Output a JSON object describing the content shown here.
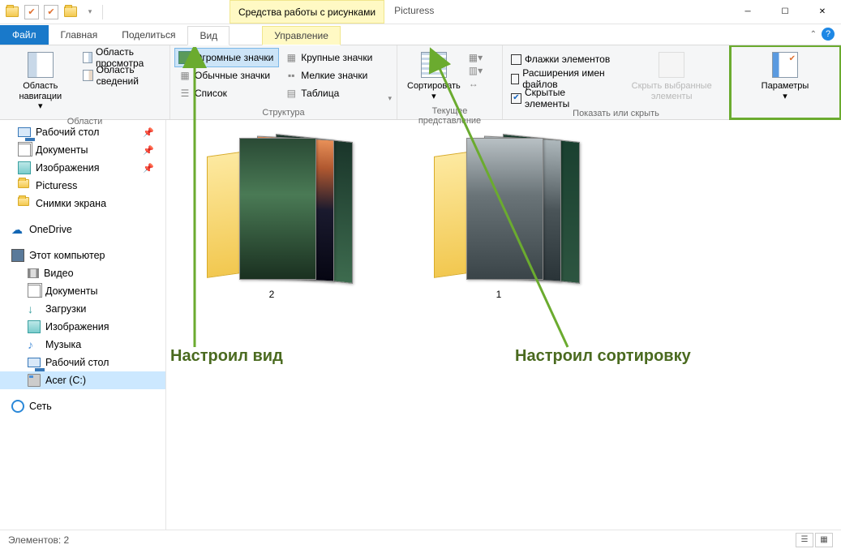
{
  "titlebar": {
    "context_tools": "Средства работы с рисунками",
    "window_title": "Picturess"
  },
  "tabs": {
    "file": "Файл",
    "home": "Главная",
    "share": "Поделиться",
    "view": "Вид",
    "manage": "Управление"
  },
  "ribbon": {
    "areas": {
      "nav_pane": "Область навигации",
      "preview_pane": "Область просмотра",
      "details_pane": "Область сведений",
      "group_label": "Области"
    },
    "layout": {
      "huge_icons": "Огромные значки",
      "large_icons": "Крупные значки",
      "medium_icons": "Обычные значки",
      "small_icons": "Мелкие значки",
      "list": "Список",
      "details": "Таблица",
      "group_label": "Структура"
    },
    "current": {
      "sort": "Сортировать",
      "group_label": "Текущее представление"
    },
    "show": {
      "checkboxes": "Флажки элементов",
      "extensions": "Расширения имен файлов",
      "hidden": "Скрытые элементы",
      "hide_selected": "Скрыть выбранные элементы",
      "group_label": "Показать или скрыть"
    },
    "options": {
      "label": "Параметры"
    }
  },
  "tree": {
    "desktop": "Рабочий стол",
    "documents": "Документы",
    "pictures": "Изображения",
    "picturess": "Picturess",
    "screenshots": "Снимки экрана",
    "onedrive": "OneDrive",
    "this_pc": "Этот компьютер",
    "videos": "Видео",
    "documents2": "Документы",
    "downloads": "Загрузки",
    "pictures2": "Изображения",
    "music": "Музыка",
    "desktop2": "Рабочий стол",
    "acer_c": "Acer (C:)",
    "network": "Сеть"
  },
  "folders": {
    "f1": "2",
    "f2": "1"
  },
  "annotations": {
    "view": "Настроил вид",
    "sort": "Настроил сортировку"
  },
  "statusbar": {
    "items": "Элементов: 2"
  }
}
